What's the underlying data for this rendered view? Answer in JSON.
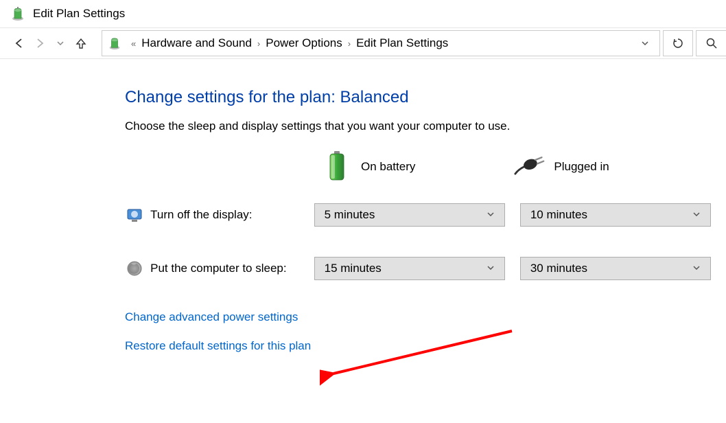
{
  "window": {
    "title": "Edit Plan Settings"
  },
  "breadcrumb": {
    "items": [
      "Hardware and Sound",
      "Power Options",
      "Edit Plan Settings"
    ]
  },
  "page": {
    "heading": "Change settings for the plan: Balanced",
    "subtext": "Choose the sleep and display settings that you want your computer to use."
  },
  "columns": {
    "battery": "On battery",
    "plugged": "Plugged in"
  },
  "settings": {
    "display": {
      "label": "Turn off the display:",
      "battery": "5 minutes",
      "plugged": "10 minutes"
    },
    "sleep": {
      "label": "Put the computer to sleep:",
      "battery": "15 minutes",
      "plugged": "30 minutes"
    }
  },
  "links": {
    "advanced": "Change advanced power settings",
    "restore": "Restore default settings for this plan"
  }
}
